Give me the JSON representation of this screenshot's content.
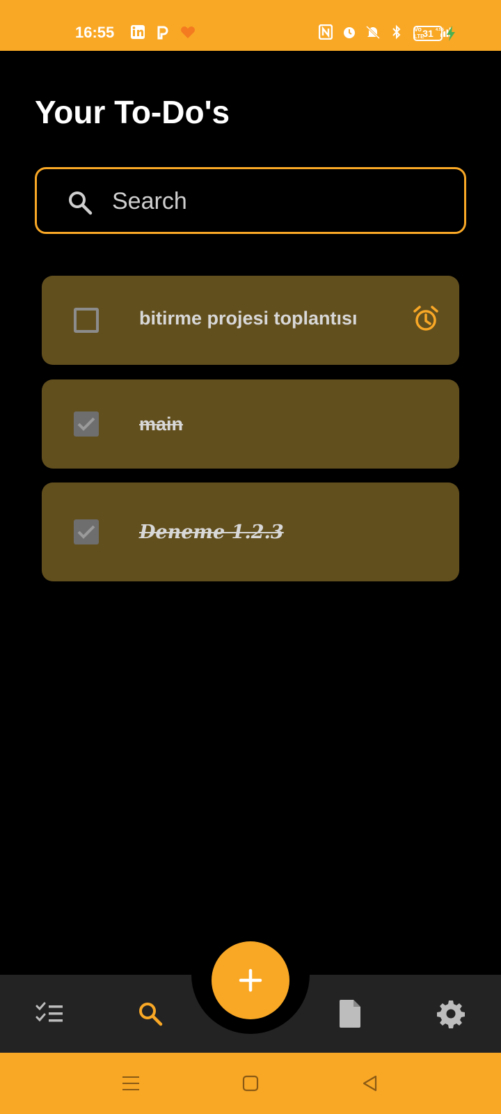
{
  "status_bar": {
    "time": "16:55",
    "battery": "31",
    "left_icons": [
      "linkedin-icon",
      "p-app-icon",
      "heart-app-icon"
    ],
    "right_icons": [
      "nfc-icon",
      "alarm-icon",
      "mute-icon",
      "bluetooth-icon",
      "volte-icon",
      "signal-icon"
    ]
  },
  "page": {
    "title": "Your To-Do's"
  },
  "search": {
    "placeholder": "Search",
    "value": ""
  },
  "todos": [
    {
      "label": "bitirme projesi toplantısı",
      "checked": false,
      "has_alarm": true
    },
    {
      "label": "main",
      "checked": true,
      "has_alarm": false
    },
    {
      "label": "Deneme 1.2.3",
      "checked": true,
      "has_alarm": false
    }
  ],
  "bottom_nav": {
    "items": [
      "tasks-icon",
      "search-icon",
      "notes-icon",
      "settings-icon"
    ],
    "fab_icon": "plus-icon"
  },
  "system_nav": {
    "items": [
      "menu-icon",
      "home-icon",
      "back-icon"
    ]
  },
  "colors": {
    "accent": "#F9A826",
    "background": "#000000",
    "card": "#624F1E",
    "nav": "#232323"
  }
}
